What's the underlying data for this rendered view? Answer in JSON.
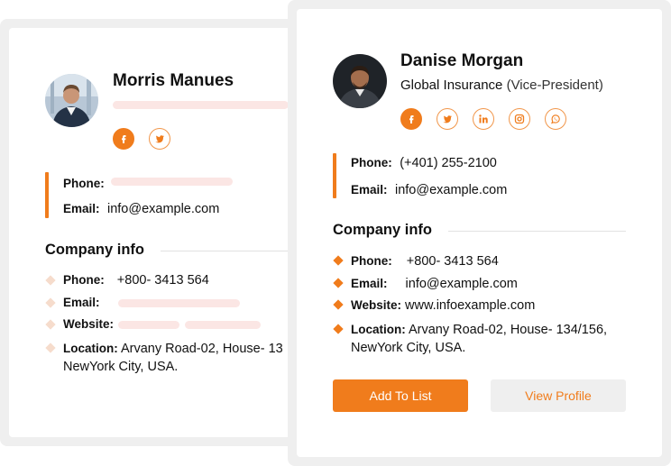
{
  "back_card": {
    "name": "Morris Manues",
    "contact": {
      "phone_label": "Phone:",
      "email_label": "Email:",
      "email_value": "info@example.com"
    },
    "company_info": {
      "title": "Company info",
      "phone_label": "Phone:",
      "phone_value": "+800- 3413 564",
      "email_label": "Email:",
      "website_label": "Website:",
      "location_label": "Location:",
      "location_line1": "Arvany Road-02, House- 13",
      "location_line2": "NewYork City, USA."
    },
    "socials": [
      "facebook-icon",
      "twitter-icon"
    ]
  },
  "front_card": {
    "name": "Danise Morgan",
    "company": "Global Insurance",
    "role": "(Vice-President)",
    "socials": [
      "facebook-icon",
      "twitter-icon",
      "linkedin-icon",
      "instagram-icon",
      "whatsapp-icon"
    ],
    "contact": {
      "phone_label": "Phone:",
      "phone_value": "(+401) 255-2100",
      "email_label": "Email:",
      "email_value": "info@example.com"
    },
    "company_info": {
      "title": "Company info",
      "phone_label": "Phone:",
      "phone_value": "+800- 3413 564",
      "email_label": "Email:",
      "email_value": "info@example.com",
      "website_label": "Website:",
      "website_value": "www.infoexample.com",
      "location_label": "Location:",
      "location_line1": "Arvany Road-02, House- 134/156,",
      "location_line2": "NewYork City, USA."
    },
    "buttons": {
      "add": "Add To List",
      "view": "View Profile"
    }
  },
  "colors": {
    "accent": "#f07c1c",
    "placeholder": "#fbe6e4",
    "card_border": "#efefef"
  }
}
